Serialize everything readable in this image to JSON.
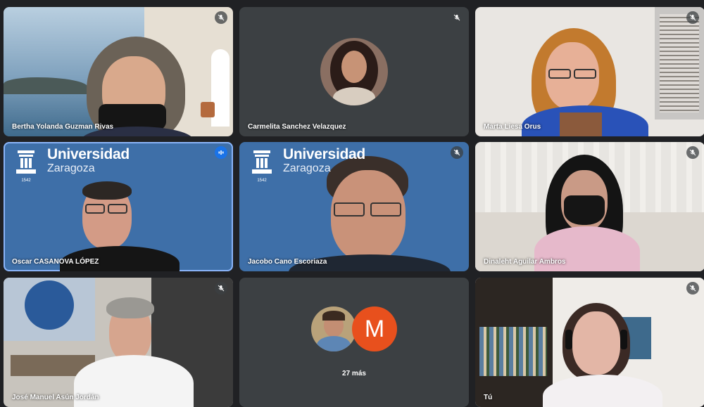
{
  "participants": [
    {
      "name": "Bertha Yolanda Guzman Rivas",
      "muted": true
    },
    {
      "name": "Carmelita Sanchez Velazquez",
      "muted": true
    },
    {
      "name": "Marta Liesa Orus",
      "muted": true
    },
    {
      "name": "Oscar CASANOVA LÓPEZ",
      "muted": false,
      "speaking": true
    },
    {
      "name": "Jacobo Cano Escoriaza",
      "muted": true
    },
    {
      "name": "Dinaleht Aguilar Ambros",
      "muted": true
    },
    {
      "name": "José Manuel Asún Jordán",
      "muted": true
    },
    {
      "name": "Tú",
      "muted": true
    }
  ],
  "overflow": {
    "count_label": "27 más",
    "avatar_letter": "M",
    "avatar_color": "#e8501d"
  },
  "university": {
    "title": "Universidad",
    "subtitle": "Zaragoza",
    "year": "1542"
  },
  "colors": {
    "background": "#202124",
    "tile": "#3c4043",
    "active_border": "#8ab4f8",
    "speaking": "#1a73e8",
    "univ_blue": "#3e6fa8"
  }
}
